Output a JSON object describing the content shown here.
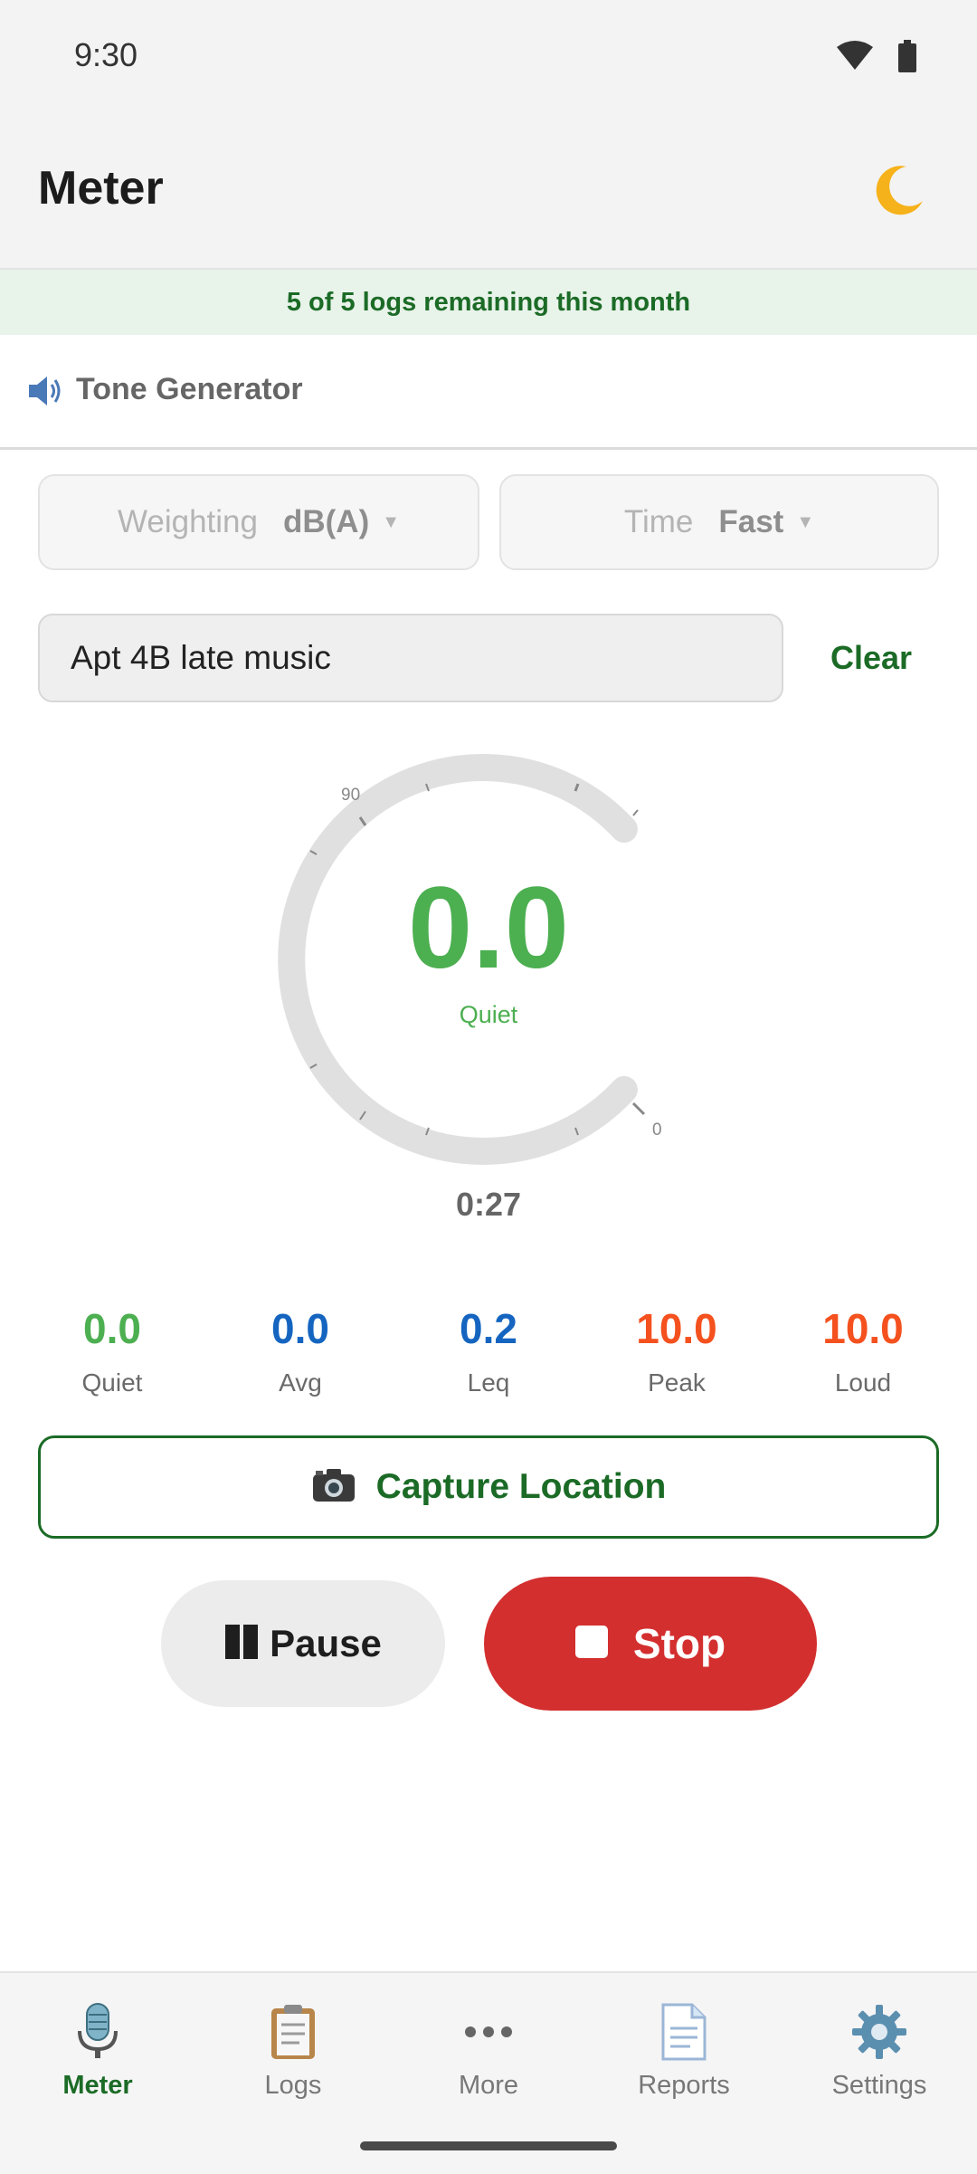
{
  "status_bar": {
    "time": "9:30"
  },
  "app_bar": {
    "title": "Meter"
  },
  "banner": {
    "text": "5 of 5 logs remaining this month"
  },
  "tone_generator": {
    "label": "Tone Generator"
  },
  "weighting": {
    "label": "Weighting",
    "value": "dB(A)"
  },
  "time_weighting": {
    "label": "Time",
    "value": "Fast"
  },
  "note": {
    "value": "Apt 4B late music",
    "clear_label": "Clear"
  },
  "gauge": {
    "reading": "0.0",
    "status": "Quiet",
    "top_tick_label": "90",
    "bottom_tick_label": "0",
    "elapsed": "0:27",
    "level_fraction": 0.0
  },
  "stats": [
    {
      "value": "0.0",
      "label": "Quiet",
      "color": "#4caf50"
    },
    {
      "value": "0.0",
      "label": "Avg",
      "color": "#1565c0"
    },
    {
      "value": "0.2",
      "label": "Leq",
      "color": "#1565c0"
    },
    {
      "value": "10.0",
      "label": "Peak",
      "color": "#f4511e"
    },
    {
      "value": "10.0",
      "label": "Loud",
      "color": "#f4511e"
    }
  ],
  "capture": {
    "label": "Capture Location"
  },
  "controls": {
    "pause_label": "Pause",
    "stop_label": "Stop"
  },
  "nav": {
    "items": [
      {
        "label": "Meter",
        "icon": "microphone-icon",
        "active": true
      },
      {
        "label": "Logs",
        "icon": "clipboard-icon",
        "active": false
      },
      {
        "label": "More",
        "icon": "more-icon",
        "active": false
      },
      {
        "label": "Reports",
        "icon": "document-icon",
        "active": false
      },
      {
        "label": "Settings",
        "icon": "gear-icon",
        "active": false
      }
    ]
  },
  "colors": {
    "accent": "#1b6b26",
    "quiet": "#4caf50",
    "stop": "#d32f2f",
    "avg": "#1565c0",
    "peak": "#f4511e"
  }
}
